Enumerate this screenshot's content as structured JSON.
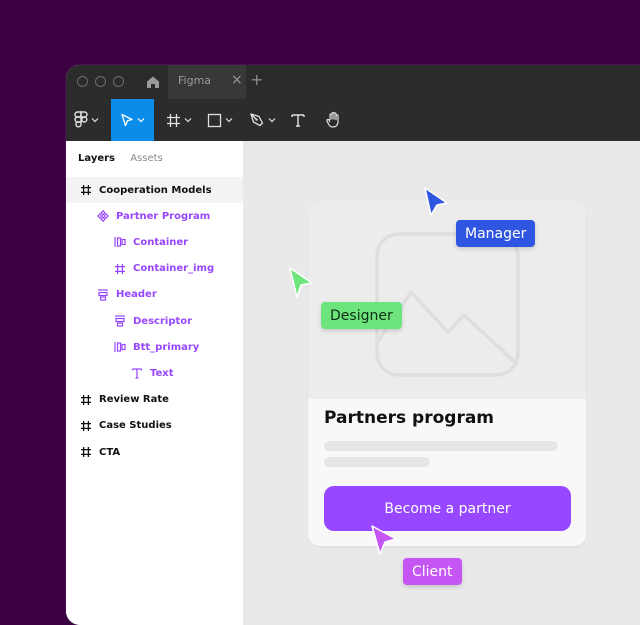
{
  "window": {
    "tab_title": "Figma",
    "tab_close": "×",
    "new_tab": "+"
  },
  "toolbar": {
    "tools": [
      "figma-menu",
      "move",
      "frame",
      "shape",
      "pen",
      "text",
      "hand"
    ],
    "active_tool": "move"
  },
  "sidebar": {
    "tabs": [
      "Layers",
      "Assets"
    ],
    "active_tab": "Layers",
    "layers": [
      {
        "label": "Cooperation Models",
        "icon": "frame-icon",
        "indent": 0,
        "color": "dark",
        "selected": true
      },
      {
        "label": "Partner Program",
        "icon": "component-icon",
        "indent": 1,
        "color": "purple"
      },
      {
        "label": "Container",
        "icon": "autolayout-horizontal-icon",
        "indent": 2,
        "color": "purple"
      },
      {
        "label": "Container_img",
        "icon": "frame-icon",
        "indent": 2,
        "color": "purple"
      },
      {
        "label": "Header",
        "icon": "autolayout-vertical-icon",
        "indent": 1,
        "color": "purple"
      },
      {
        "label": "Descriptor",
        "icon": "autolayout-vertical-icon",
        "indent": 2,
        "color": "purple"
      },
      {
        "label": "Btt_primary",
        "icon": "autolayout-horizontal-icon",
        "indent": 2,
        "color": "purple"
      },
      {
        "label": "Text",
        "icon": "text-icon",
        "indent": 3,
        "color": "purple"
      },
      {
        "label": "Review Rate",
        "icon": "frame-icon",
        "indent": 0,
        "color": "dark"
      },
      {
        "label": "Case Studies",
        "icon": "frame-icon",
        "indent": 0,
        "color": "dark"
      },
      {
        "label": "CTA",
        "icon": "frame-icon",
        "indent": 0,
        "color": "dark"
      }
    ]
  },
  "card": {
    "title": "Partners program",
    "button_label": "Become a partner"
  },
  "collaborators": {
    "manager": {
      "name": "Manager",
      "color": "#2f56e0"
    },
    "designer": {
      "name": "Designer",
      "color": "#6de47c"
    },
    "client": {
      "name": "Client",
      "color": "#c556f3"
    }
  },
  "colors": {
    "background": "#3b0042",
    "accent": "#9747ff",
    "active_tool": "#0c8ce9"
  }
}
